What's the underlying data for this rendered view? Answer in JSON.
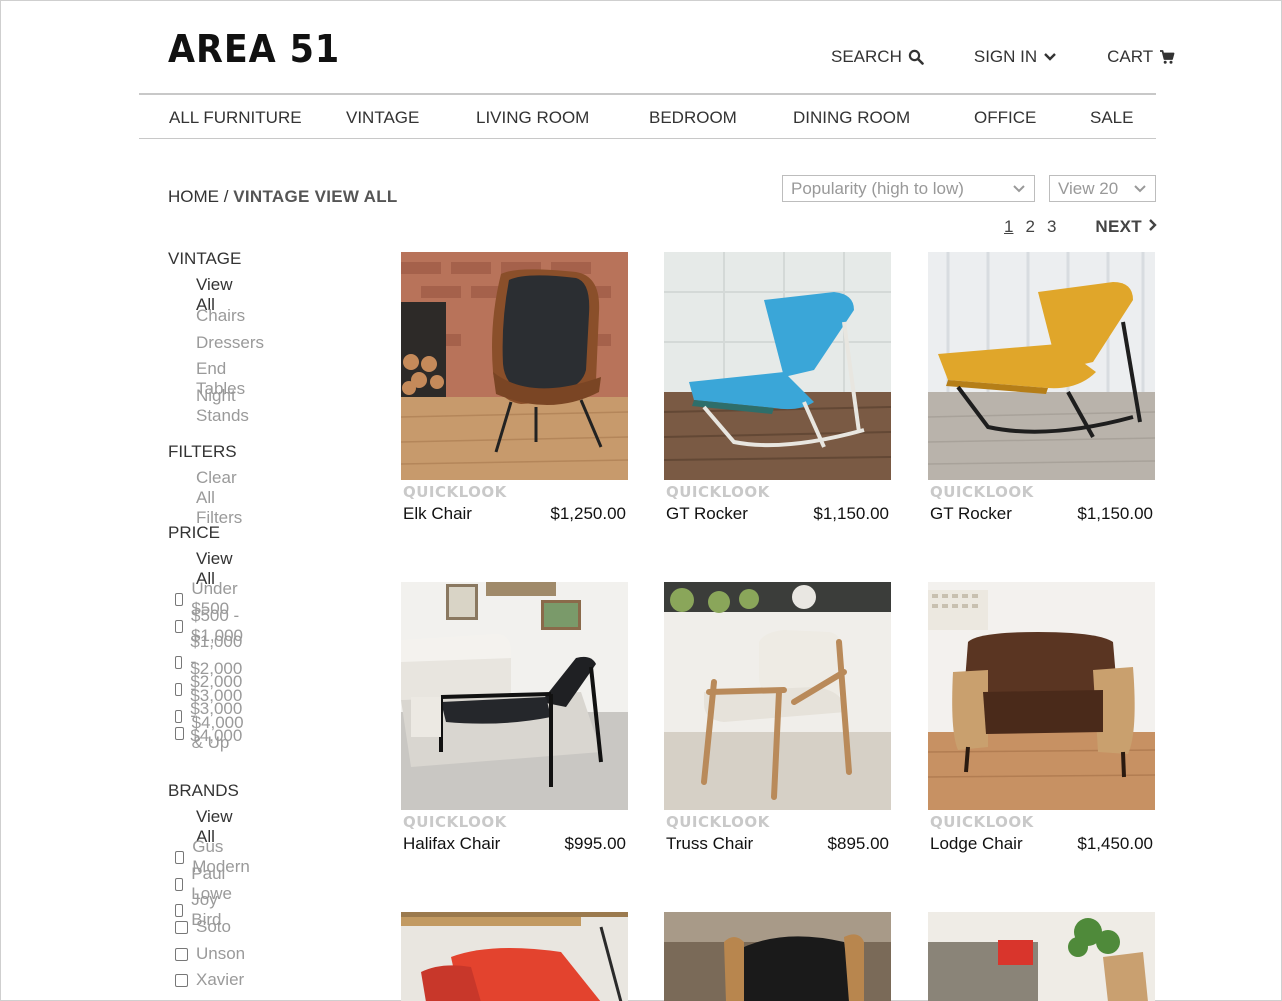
{
  "brand": {
    "logo_text": "AREA 51"
  },
  "topnav": {
    "search": "SEARCH",
    "signin": "SIGN IN",
    "cart": "CART"
  },
  "categories": [
    "ALL FURNITURE",
    "VINTAGE",
    "LIVING ROOM",
    "BEDROOM",
    "DINING ROOM",
    "OFFICE",
    "SALE"
  ],
  "breadcrumb": {
    "home": "HOME",
    "separator": "/",
    "current": "VINTAGE VIEW ALL"
  },
  "sort": {
    "selected": "Popularity (high to low)"
  },
  "per_page": {
    "selected": "View 20"
  },
  "pagination": {
    "pages": [
      "1",
      "2",
      "3"
    ],
    "current": "1",
    "next": "NEXT"
  },
  "sidebar": {
    "vintage": {
      "heading": "VINTAGE",
      "view_all": "View All",
      "items": [
        "Chairs",
        "Dressers",
        "End Tables",
        "Night Stands"
      ]
    },
    "filters": {
      "heading": "FILTERS",
      "clear": "Clear All Filters"
    },
    "price": {
      "heading": "PRICE",
      "view_all": "View All",
      "options": [
        "Under $500",
        "$500 - $1,000",
        "$1,000 - $2,000",
        "$2,000 - $3,000",
        "$3,000 - $4,000",
        "$4,000 & Up"
      ]
    },
    "brands": {
      "heading": "BRANDS",
      "view_all": "View All",
      "options": [
        "Gus Modern",
        "Paul Lowe",
        "Joy Bird",
        "Soto",
        "Unson",
        "Xavier"
      ]
    }
  },
  "quicklook_label": "QUICKLOOK",
  "products": [
    {
      "name": "Elk Chair",
      "price": "$1,250.00"
    },
    {
      "name": "GT Rocker",
      "price": "$1,150.00"
    },
    {
      "name": "GT Rocker",
      "price": "$1,150.00"
    },
    {
      "name": "Halifax Chair",
      "price": "$995.00"
    },
    {
      "name": "Truss Chair",
      "price": "$895.00"
    },
    {
      "name": "Lodge Chair",
      "price": "$1,450.00"
    }
  ],
  "colors": {
    "accent_blue": "#3aa6d8",
    "mustard": "#e0a62a",
    "walnut": "#7a4a2a",
    "leather": "#5a3522"
  }
}
